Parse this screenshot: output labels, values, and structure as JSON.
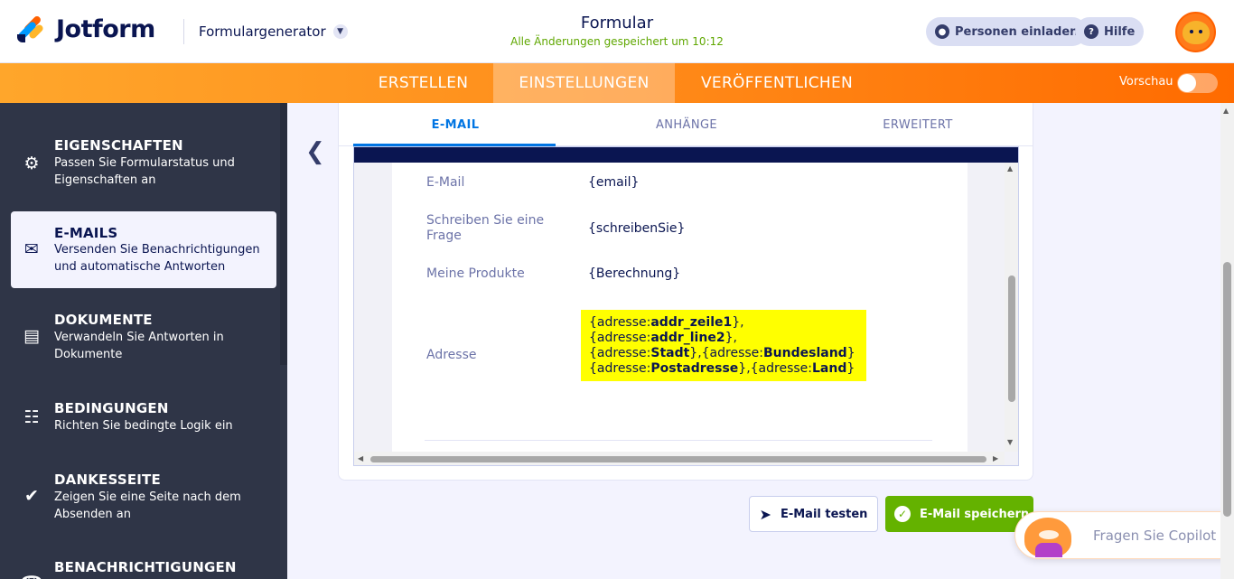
{
  "header": {
    "logo_text": "Jotform",
    "builder_label": "Formulargenerator",
    "form_title": "Formular",
    "save_status": "Alle Änderungen gespeichert um 10:12",
    "invite_label": "Personen einladen",
    "help_label": "Hilfe"
  },
  "nav": {
    "tabs": [
      {
        "label": "ERSTELLEN"
      },
      {
        "label": "EINSTELLUNGEN"
      },
      {
        "label": "VERÖFFENTLICHEN"
      }
    ],
    "active_tab": "EINSTELLUNGEN",
    "preview_label": "Vorschau",
    "preview_on": false
  },
  "sidebar": {
    "items": [
      {
        "title": "EIGENSCHAFTEN",
        "desc": "Passen Sie Formularstatus und Eigenschaften an",
        "icon": "gear-icon"
      },
      {
        "title": "E-MAILS",
        "desc": "Versenden Sie Benachrichtigungen und automatische Antworten",
        "icon": "envelope-icon"
      },
      {
        "title": "DOKUMENTE",
        "desc": "Verwandeln Sie Antworten in Dokumente",
        "icon": "document-icon"
      },
      {
        "title": "BEDINGUNGEN",
        "desc": "Richten Sie bedingte Logik ein",
        "icon": "sitemap-icon"
      },
      {
        "title": "DANKESSEITE",
        "desc": "Zeigen Sie eine Seite nach dem Absenden an",
        "icon": "check-circle-icon"
      },
      {
        "title": "BENACHRICHTIGUNGEN",
        "desc": "",
        "icon": "bell-icon"
      }
    ],
    "active_item": "E-MAILS"
  },
  "editor": {
    "tabs": [
      {
        "label": "E-MAIL"
      },
      {
        "label": "ANHÄNGE"
      },
      {
        "label": "ERWEITERT"
      }
    ],
    "active_tab": "E-MAIL",
    "rows": [
      {
        "label": "E-Mail",
        "value": "{email}"
      },
      {
        "label": "Schreiben Sie eine Frage",
        "value": "{schreibenSie}"
      },
      {
        "label": "Meine Produkte",
        "value": "{Berechnung}"
      }
    ],
    "address": {
      "label": "Adresse",
      "p1": "{adresse:",
      "b1": "addr_zeile1",
      "s1": "},",
      "p2": "{adresse:",
      "b2": "addr_line2",
      "s2": "},",
      "p3": "{adresse:",
      "b3": "Stadt",
      "s3": "},{adresse:",
      "b4": "Bundesland",
      "s4": "}",
      "p5": "{adresse:",
      "b5": "Postadresse",
      "s5": "},{adresse:",
      "b6": "Land",
      "s6": "}",
      "highlight_color": "#ffff00"
    }
  },
  "actions": {
    "test_label": "E-Mail testen",
    "save_label": "E-Mail speichern"
  },
  "copilot": {
    "label": "Fragen Sie Copilot"
  },
  "colors": {
    "brand_navy": "#0a1551",
    "orange": "#ff6100",
    "green": "#64b200",
    "blue": "#0075e3",
    "sidebar_bg": "#2f3547"
  }
}
